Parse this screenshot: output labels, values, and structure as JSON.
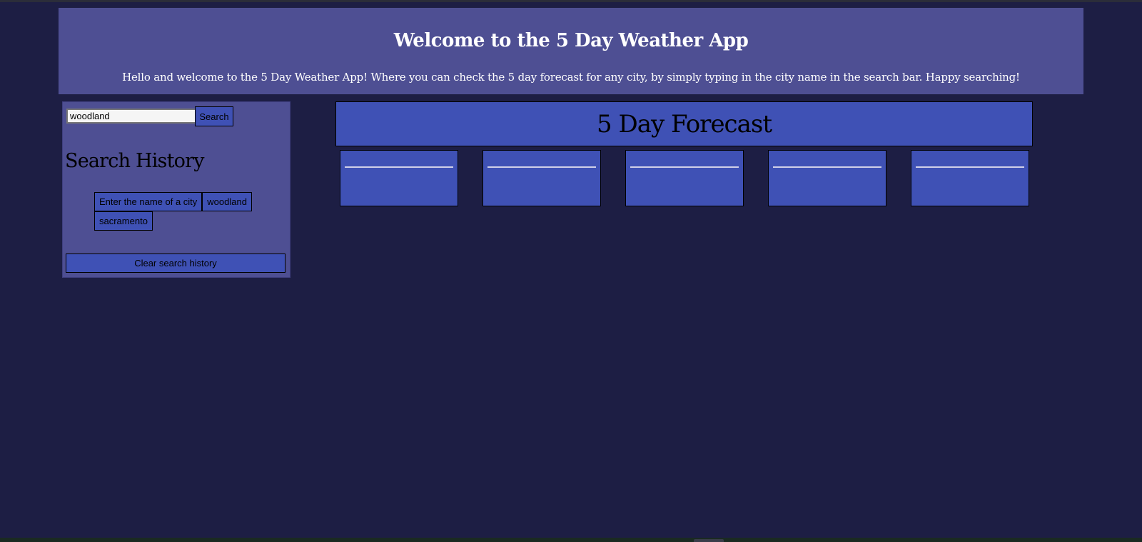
{
  "header": {
    "title": "Welcome to the 5 Day Weather App",
    "subtitle": "Hello and welcome to the 5 Day Weather App! Where you can check the 5 day forecast for any city, by simply typing in the city name in the search bar. Happy searching!"
  },
  "search": {
    "value": "woodland",
    "button_label": "Search"
  },
  "history": {
    "title": "Search History",
    "items": [
      {
        "label": "Enter the name of a city"
      },
      {
        "label": "woodland"
      },
      {
        "label": "sacramento"
      }
    ],
    "clear_label": "Clear search history"
  },
  "forecast": {
    "title": "5 Day Forecast",
    "card_count": 5
  },
  "colors": {
    "page_background": "#1d1e44",
    "panel_background": "#4e4f93",
    "accent_blue": "#3f51b5"
  }
}
